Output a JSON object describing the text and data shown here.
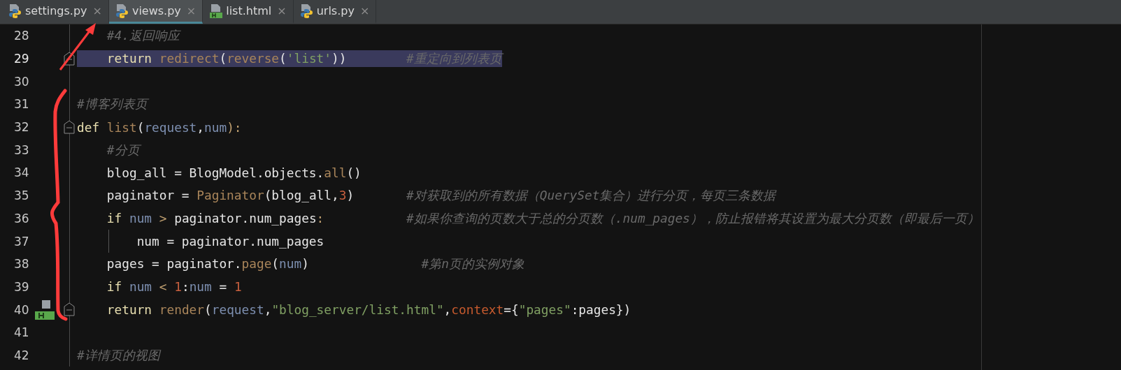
{
  "tabs": [
    {
      "label": "settings.py",
      "kind": "python",
      "selected": false,
      "close": "×"
    },
    {
      "label": "views.py",
      "kind": "python",
      "selected": true,
      "close": "×"
    },
    {
      "label": "list.html",
      "kind": "html",
      "selected": false,
      "close": "×"
    },
    {
      "label": "urls.py",
      "kind": "python",
      "selected": false,
      "close": "×"
    }
  ],
  "lines": [
    {
      "number": "28",
      "kind": "plain",
      "selected": false,
      "fold": false,
      "indent_guide": false,
      "tokens": [
        {
          "text": "    #4.返回响应",
          "kind": "comment"
        }
      ]
    },
    {
      "number": "29",
      "kind": "plain",
      "selected": true,
      "fold": true,
      "indent_guide": false,
      "tokens": [
        {
          "text": "    return ",
          "kind": "keyword"
        },
        {
          "text": "redirect",
          "kind": "function"
        },
        {
          "text": "(",
          "kind": "plain"
        },
        {
          "text": "reverse",
          "kind": "function"
        },
        {
          "text": "(",
          "kind": "plain"
        },
        {
          "text": "'list'",
          "kind": "string"
        },
        {
          "text": "))",
          "kind": "plain"
        },
        {
          "text": "        #重定向到列表页",
          "kind": "comment"
        }
      ]
    },
    {
      "number": "30",
      "kind": "plain",
      "selected": false,
      "fold": false,
      "indent_guide": false
    },
    {
      "number": "31",
      "kind": "plain",
      "selected": false,
      "fold": false,
      "indent_guide": false,
      "tokens": [
        {
          "text": "#博客列表页",
          "kind": "comment"
        }
      ]
    },
    {
      "number": "32",
      "kind": "plain",
      "selected": false,
      "fold": true,
      "indent_guide": false,
      "tokens": [
        {
          "text": "def ",
          "kind": "keyword"
        },
        {
          "text": "list",
          "kind": "function"
        },
        {
          "text": "(",
          "kind": "plain"
        },
        {
          "text": "request",
          "kind": "param"
        },
        {
          "text": ",",
          "kind": "plain"
        },
        {
          "text": "num",
          "kind": "param"
        },
        {
          "text": "):",
          "kind": "op"
        }
      ]
    },
    {
      "number": "33",
      "kind": "plain",
      "selected": false,
      "fold": false,
      "indent_guide": false,
      "tokens": [
        {
          "text": "    #分页",
          "kind": "comment"
        }
      ]
    },
    {
      "number": "34",
      "kind": "plain",
      "selected": false,
      "fold": false,
      "indent_guide": false,
      "tokens": [
        {
          "text": "    blog_all = BlogModel.objects.",
          "kind": "plain"
        },
        {
          "text": "all",
          "kind": "function"
        },
        {
          "text": "()",
          "kind": "plain"
        }
      ]
    },
    {
      "number": "35",
      "kind": "plain",
      "selected": false,
      "fold": false,
      "indent_guide": false,
      "tokens": [
        {
          "text": "    paginator = ",
          "kind": "plain"
        },
        {
          "text": "Paginator",
          "kind": "function"
        },
        {
          "text": "(blog_all,",
          "kind": "plain"
        },
        {
          "text": "3",
          "kind": "number"
        },
        {
          "text": ")",
          "kind": "plain"
        },
        {
          "text": "       #对获取到的所有数据（QuerySet集合）进行分页，每页三条数据",
          "kind": "comment"
        }
      ]
    },
    {
      "number": "36",
      "kind": "plain",
      "selected": false,
      "fold": false,
      "indent_guide": false,
      "tokens": [
        {
          "text": "    if ",
          "kind": "keyword"
        },
        {
          "text": "num",
          "kind": "param"
        },
        {
          "text": " > ",
          "kind": "op"
        },
        {
          "text": "paginator.num_pages",
          "kind": "plain"
        },
        {
          "text": ":",
          "kind": "op"
        },
        {
          "text": "           #如果你查询的页数大于总的分页数（.num_pages），防止报错将其设置为最大分页数（即最后一页）",
          "kind": "comment"
        }
      ]
    },
    {
      "number": "37",
      "kind": "plain",
      "selected": false,
      "fold": false,
      "indent_guide": true,
      "tokens": [
        {
          "text": "        num = paginator.num_pages",
          "kind": "plain"
        }
      ]
    },
    {
      "number": "38",
      "kind": "plain",
      "selected": false,
      "fold": false,
      "indent_guide": false,
      "tokens": [
        {
          "text": "    pages = paginator.",
          "kind": "plain"
        },
        {
          "text": "page",
          "kind": "function"
        },
        {
          "text": "(",
          "kind": "plain"
        },
        {
          "text": "num",
          "kind": "param"
        },
        {
          "text": ")",
          "kind": "plain"
        },
        {
          "text": "               #第n页的实例对象",
          "kind": "comment"
        }
      ]
    },
    {
      "number": "39",
      "kind": "plain",
      "selected": false,
      "fold": false,
      "indent_guide": false,
      "tokens": [
        {
          "text": "    if ",
          "kind": "keyword"
        },
        {
          "text": "num",
          "kind": "param"
        },
        {
          "text": " < ",
          "kind": "op"
        },
        {
          "text": "1",
          "kind": "number"
        },
        {
          "text": ":",
          "kind": "plain"
        },
        {
          "text": "num",
          "kind": "param"
        },
        {
          "text": " = ",
          "kind": "plain"
        },
        {
          "text": "1",
          "kind": "number"
        }
      ]
    },
    {
      "number": "40",
      "kind": "marked",
      "selected": false,
      "fold": true,
      "indent_guide": false,
      "tokens": [
        {
          "text": "    return ",
          "kind": "keyword"
        },
        {
          "text": "render",
          "kind": "function"
        },
        {
          "text": "(",
          "kind": "plain"
        },
        {
          "text": "request",
          "kind": "param"
        },
        {
          "text": ",",
          "kind": "plain"
        },
        {
          "text": "\"blog_server/list.html\"",
          "kind": "string"
        },
        {
          "text": ",",
          "kind": "plain"
        },
        {
          "text": "context",
          "kind": "kwarg"
        },
        {
          "text": "={",
          "kind": "plain"
        },
        {
          "text": "\"pages\"",
          "kind": "string"
        },
        {
          "text": ":pages})",
          "kind": "plain"
        }
      ]
    },
    {
      "number": "41",
      "kind": "plain",
      "selected": false,
      "fold": false,
      "indent_guide": false
    },
    {
      "number": "42",
      "kind": "plain",
      "selected": false,
      "fold": false,
      "indent_guide": false,
      "tokens": [
        {
          "text": "#详情页的视图",
          "kind": "comment"
        }
      ]
    }
  ]
}
